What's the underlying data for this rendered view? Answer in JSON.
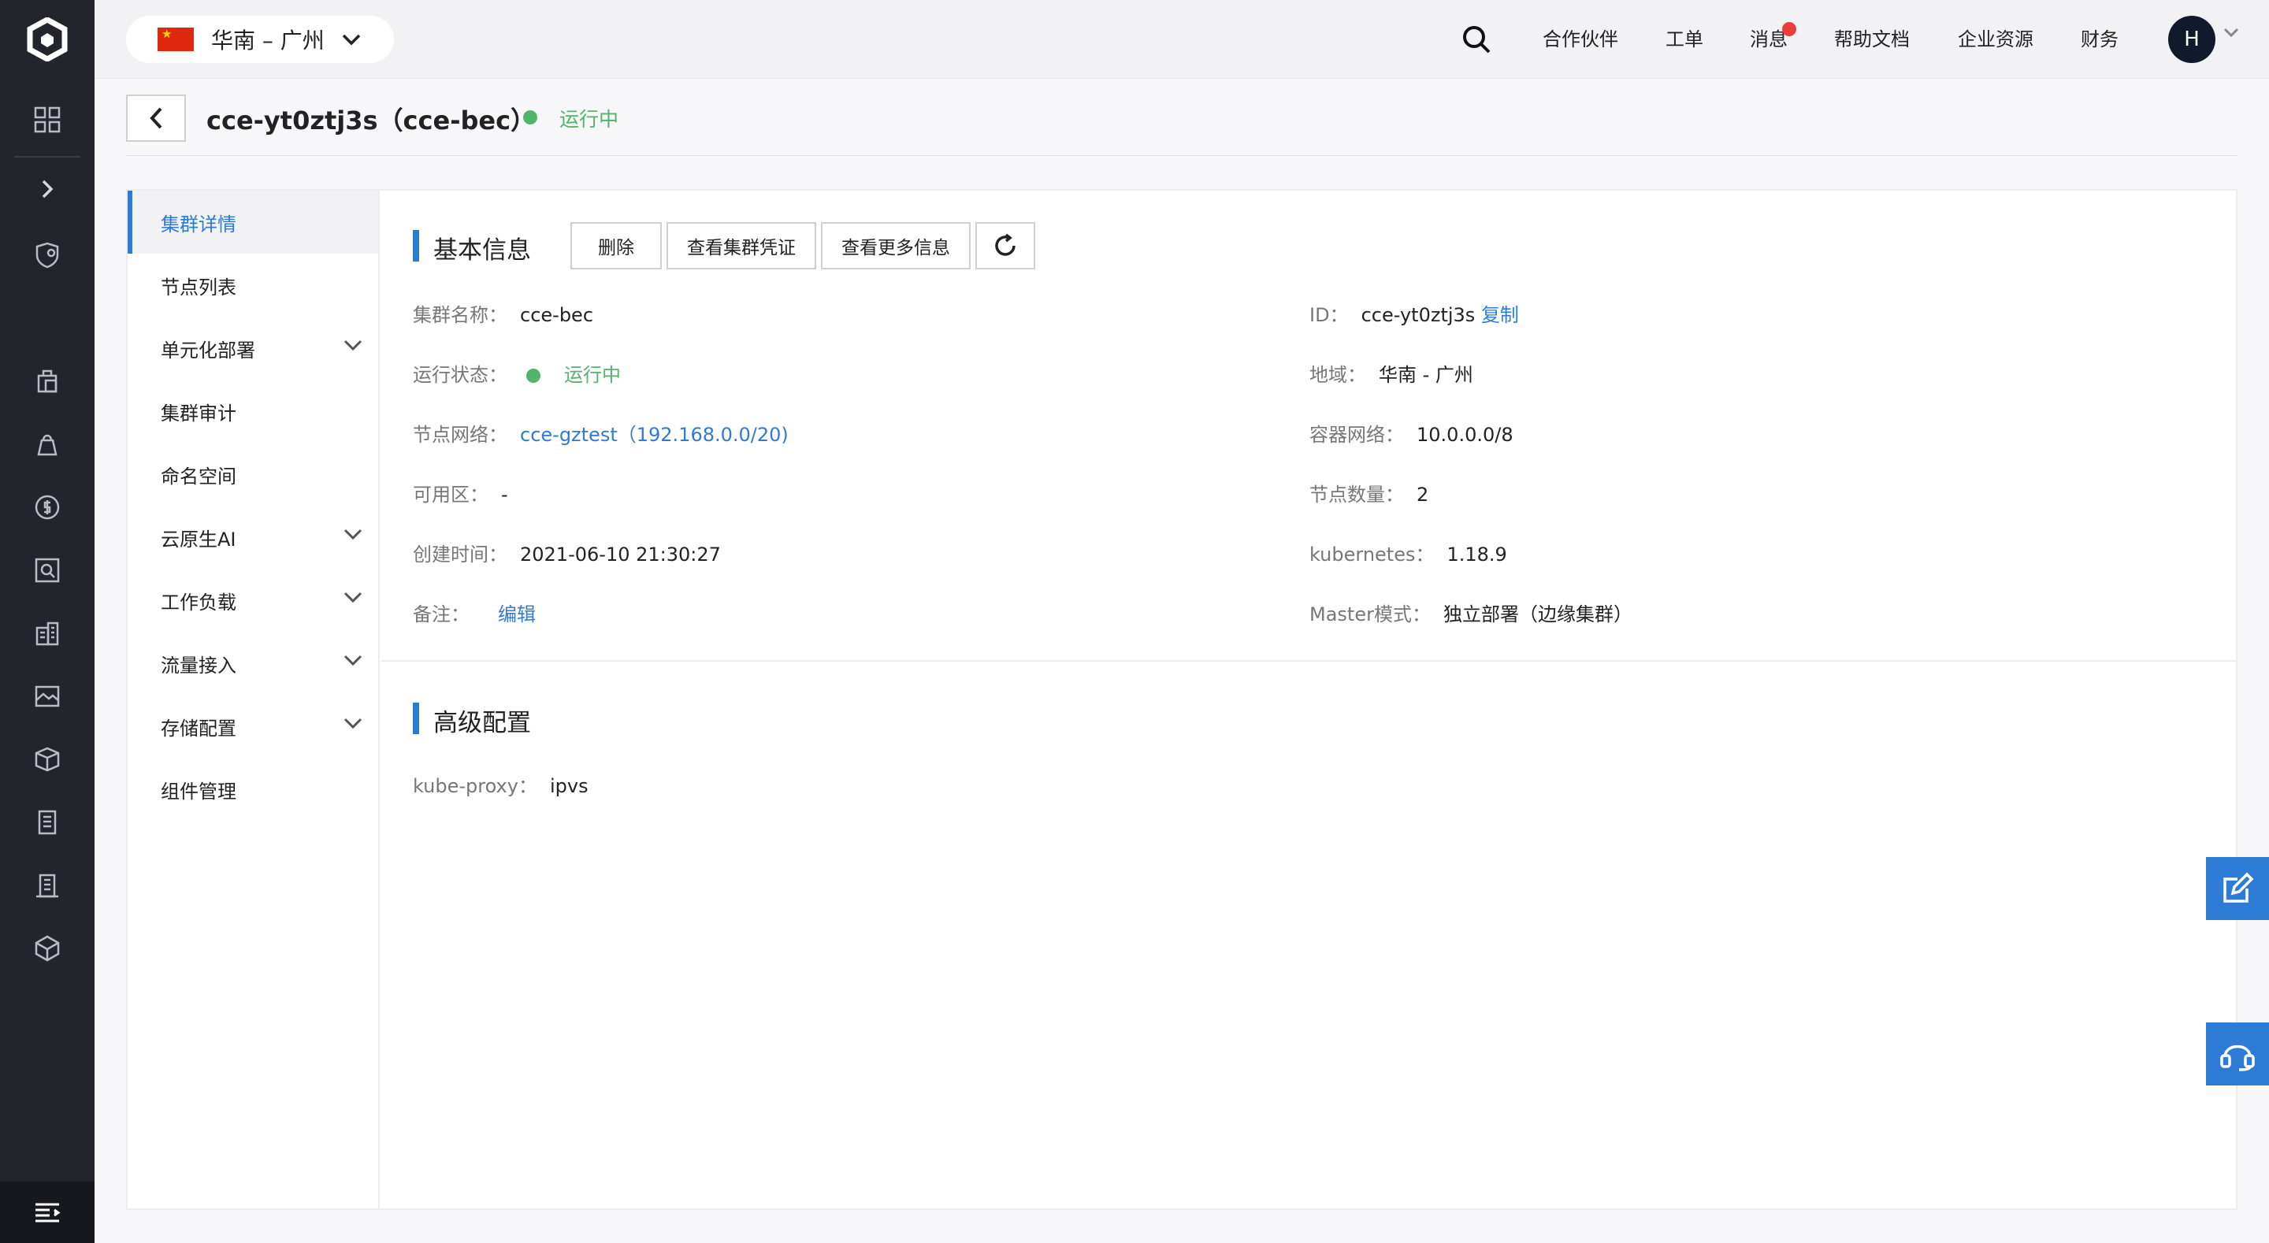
{
  "topbar": {
    "region": "华南 – 广州",
    "nav": [
      "合作伙伴",
      "工单",
      "消息",
      "帮助文档",
      "企业资源",
      "财务"
    ],
    "avatar_letter": "H"
  },
  "header": {
    "title": "cce-yt0ztj3s（cce-bec）",
    "status": "运行中"
  },
  "sidenav": {
    "items": [
      {
        "label": "集群详情"
      },
      {
        "label": "节点列表"
      },
      {
        "label": "单元化部署"
      },
      {
        "label": "集群审计"
      },
      {
        "label": "命名空间"
      },
      {
        "label": "云原生AI"
      },
      {
        "label": "工作负载"
      },
      {
        "label": "流量接入"
      },
      {
        "label": "存储配置"
      },
      {
        "label": "组件管理"
      }
    ]
  },
  "basic": {
    "title": "基本信息",
    "buttons": {
      "delete": "删除",
      "credentials": "查看集群凭证",
      "more": "查看更多信息"
    },
    "fields": {
      "name_k": "集群名称：",
      "name_v": "cce-bec",
      "status_k": "运行状态：",
      "status_v": "运行中",
      "node_net_k": "节点网络：",
      "node_net_v": "cce-gztest（192.168.0.0/20)",
      "zone_k": "可用区：",
      "zone_v": "-",
      "created_k": "创建时间：",
      "created_v": "2021-06-10 21:30:27",
      "remark_k": "备注：",
      "remark_v": "编辑",
      "id_k": "ID：",
      "id_v": "cce-yt0ztj3s",
      "id_copy": "复制",
      "region_k": "地域：",
      "region_v": "华南 - 广州",
      "container_net_k": "容器网络：",
      "container_net_v": "10.0.0.0/8",
      "node_count_k": "节点数量：",
      "node_count_v": "2",
      "k8s_k": "kubernetes：",
      "k8s_v": "1.18.9",
      "master_k": "Master模式：",
      "master_v": "独立部署（边缘集群）"
    }
  },
  "advanced": {
    "title": "高级配置",
    "proxy_k": "kube-proxy：",
    "proxy_v": "ipvs"
  },
  "colors": {
    "accent": "#2e7bd6",
    "ok": "#52b46b",
    "rail": "#23252d"
  }
}
